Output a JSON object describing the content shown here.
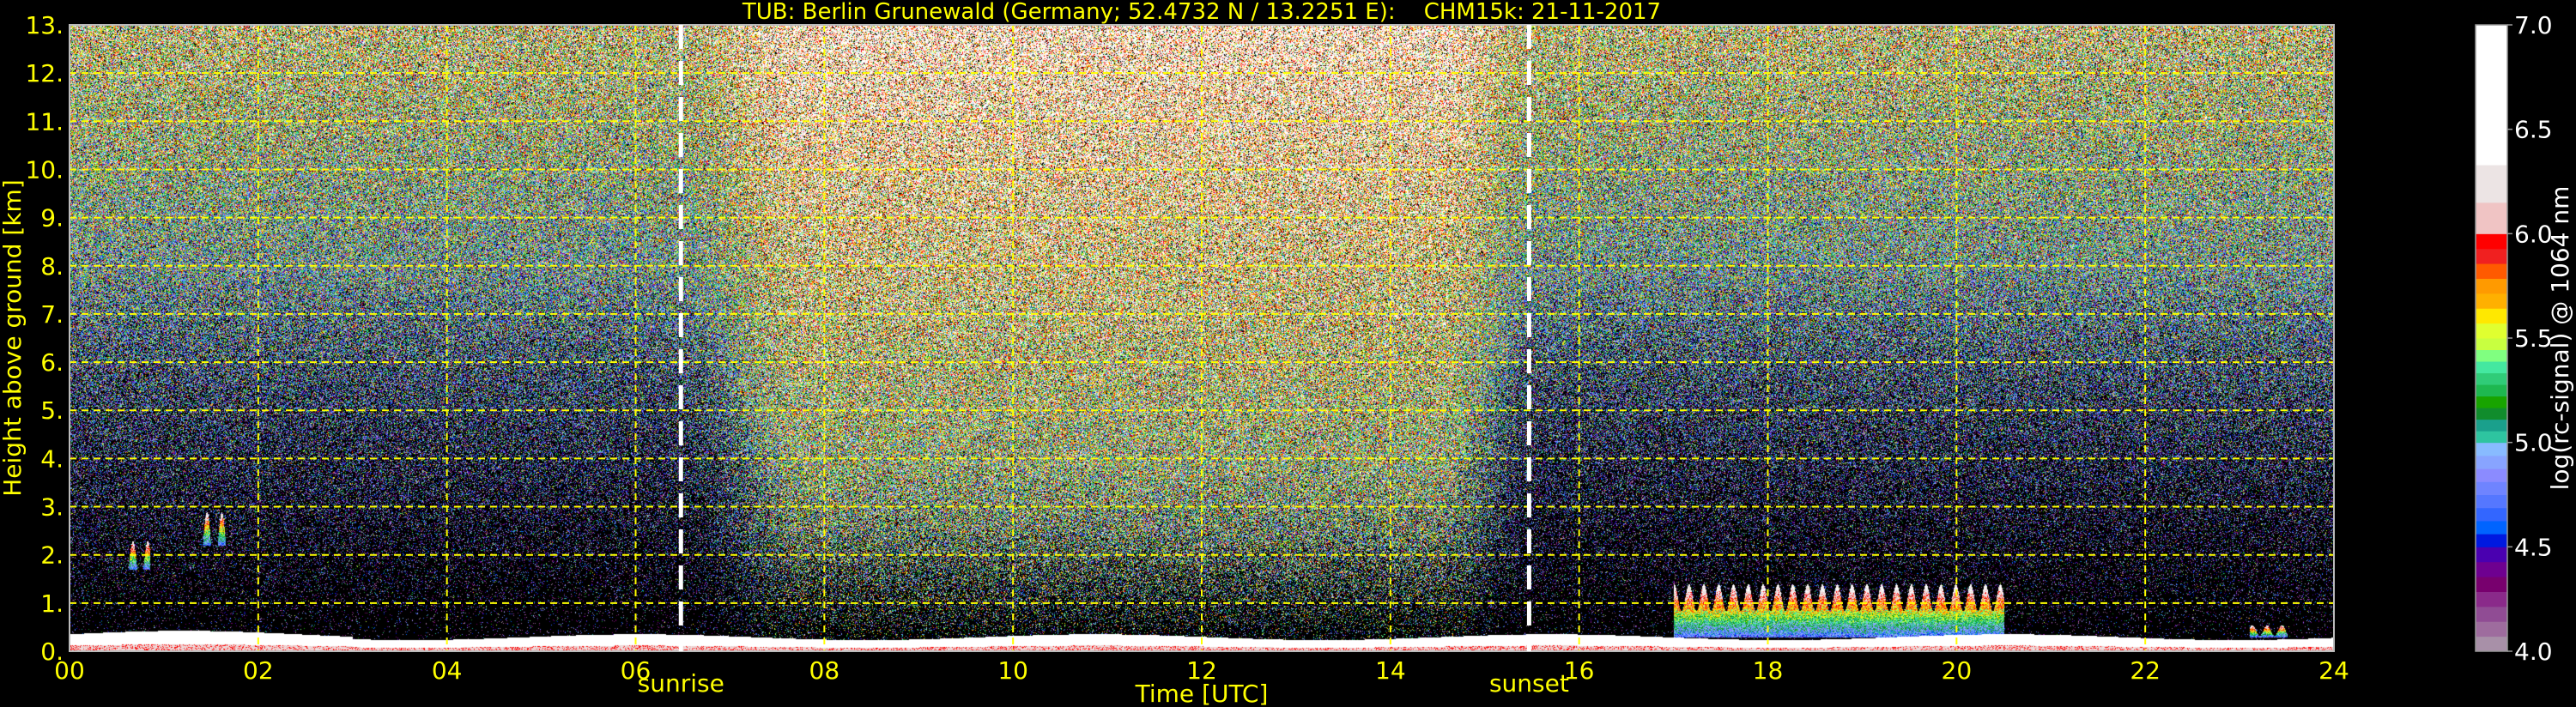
{
  "chart_data": {
    "type": "heatmap",
    "title": "TUB: Berlin Grunewald (Germany; 52.4732 N / 13.2251 E):    CHM15k: 21-11-2017",
    "xlabel": "Time [UTC]",
    "ylabel": "Height above ground [km]",
    "xlim": [
      0,
      24
    ],
    "ylim": [
      0,
      13
    ],
    "xticks": [
      0,
      2,
      4,
      6,
      8,
      10,
      12,
      14,
      16,
      18,
      20,
      22,
      24
    ],
    "xtick_labels": [
      "00",
      "02",
      "04",
      "06",
      "08",
      "10",
      "12",
      "14",
      "16",
      "18",
      "20",
      "22",
      "24"
    ],
    "yticks": [
      0,
      1,
      2,
      3,
      4,
      5,
      6,
      7,
      8,
      9,
      10,
      11,
      12,
      13
    ],
    "ytick_labels": [
      "0.",
      "1.",
      "2.",
      "3.",
      "4.",
      "5.",
      "6.",
      "7.",
      "8.",
      "9.",
      "10.",
      "11.",
      "12.",
      "13."
    ],
    "grid": true,
    "grid_color": "#ffff00",
    "text_color": "#ffff00",
    "annotations": [
      {
        "label": "sunrise",
        "x": 6.48
      },
      {
        "label": "sunset",
        "x": 15.47
      }
    ],
    "features": {
      "surface_layer_top_km": 0.3,
      "daytime_signal_hours": [
        7.0,
        15.5
      ],
      "clouds": [
        {
          "t_start": 0.55,
          "t_end": 0.85,
          "h_bottom": 1.7,
          "h_top": 2.3
        },
        {
          "t_start": 1.35,
          "t_end": 1.65,
          "h_bottom": 2.2,
          "h_top": 2.9
        },
        {
          "t_start": 17.0,
          "t_end": 20.5,
          "h_bottom": 0.3,
          "h_top": 1.4
        },
        {
          "t_start": 23.1,
          "t_end": 23.5,
          "h_bottom": 0.3,
          "h_top": 0.55
        }
      ]
    },
    "colorbar": {
      "label": "log(rc-signal) @ 1064 nm",
      "range": [
        4.0,
        7.0
      ],
      "ticks": [
        4.0,
        4.5,
        5.0,
        5.5,
        6.0,
        6.5,
        7.0
      ],
      "tick_labels": [
        "4.0",
        "4.5",
        "5.0",
        "5.5",
        "6.0",
        "6.5",
        "7.0"
      ],
      "segments": [
        {
          "from": 4.0,
          "to": 4.5,
          "colors": [
            "#a890a8",
            "#9e6c9e",
            "#904c94",
            "#8a2a8a",
            "#78006e",
            "#6e0090",
            "#4a00b0"
          ]
        },
        {
          "from": 4.5,
          "to": 5.0,
          "colors": [
            "#0019e0",
            "#0064ff",
            "#3366ff",
            "#5577ff",
            "#6f84ff",
            "#8b8bff",
            "#88a4ff",
            "#88bbff"
          ]
        },
        {
          "from": 5.0,
          "to": 5.5,
          "colors": [
            "#2ec4a0",
            "#1aa08c",
            "#108c2c",
            "#18a400",
            "#1eb850",
            "#30cc78",
            "#44e8a0",
            "#80ff80",
            "#c8ff40"
          ]
        },
        {
          "from": 5.5,
          "to": 6.0,
          "colors": [
            "#e0ff30",
            "#ffe800",
            "#ffb000",
            "#ff9a00",
            "#ff5a00",
            "#f02020",
            "#ff0000"
          ]
        },
        {
          "from": 6.0,
          "to": 6.15,
          "colors": [
            "#f0c4c4"
          ]
        },
        {
          "from": 6.15,
          "to": 6.33,
          "colors": [
            "#ece4e4"
          ]
        },
        {
          "from": 6.33,
          "to": 7.0,
          "colors": [
            "#ffffff"
          ]
        }
      ]
    }
  }
}
